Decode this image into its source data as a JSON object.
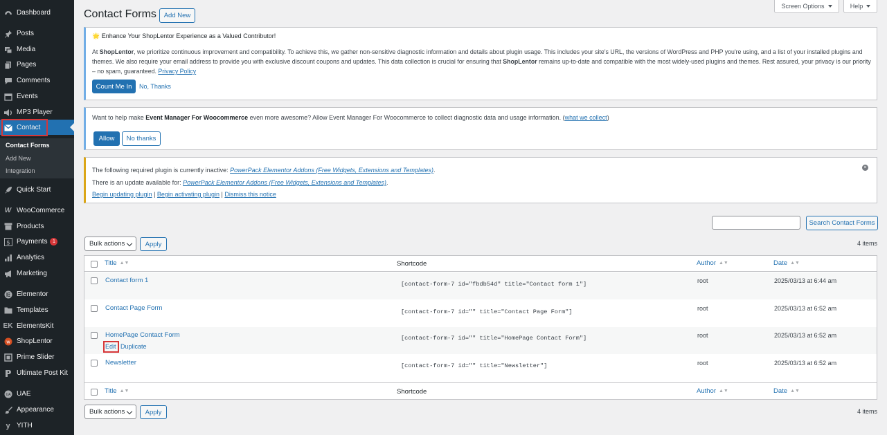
{
  "sidebar": {
    "items": [
      {
        "label": "Dashboard",
        "icon": "dashboard-icon"
      },
      {
        "label": "Posts",
        "icon": "pin-icon"
      },
      {
        "label": "Media",
        "icon": "media-icon"
      },
      {
        "label": "Pages",
        "icon": "page-icon"
      },
      {
        "label": "Comments",
        "icon": "comment-icon"
      },
      {
        "label": "Events",
        "icon": "calendar-icon"
      },
      {
        "label": "MP3 Player",
        "icon": "speaker-icon"
      },
      {
        "label": "Contact",
        "icon": "mail-icon"
      },
      {
        "label": "Quick Start",
        "icon": "rocket-icon"
      },
      {
        "label": "WooCommerce",
        "icon": "woo-icon"
      },
      {
        "label": "Products",
        "icon": "archive-icon"
      },
      {
        "label": "Payments",
        "icon": "dollar-icon",
        "badge": "1"
      },
      {
        "label": "Analytics",
        "icon": "bar-chart-icon"
      },
      {
        "label": "Marketing",
        "icon": "megaphone-icon"
      },
      {
        "label": "Elementor",
        "icon": "elementor-icon"
      },
      {
        "label": "Templates",
        "icon": "folder-icon"
      },
      {
        "label": "ElementsKit",
        "icon": "ek-icon"
      },
      {
        "label": "ShopLentor",
        "icon": "shoplentor-icon"
      },
      {
        "label": "Prime Slider",
        "icon": "slider-icon"
      },
      {
        "label": "Ultimate Post Kit",
        "icon": "upk-icon"
      },
      {
        "label": "UAE",
        "icon": "uae-icon"
      },
      {
        "label": "Appearance",
        "icon": "brush-icon"
      },
      {
        "label": "YITH",
        "icon": "yith-icon"
      }
    ],
    "submenu": [
      "Contact Forms",
      "Add New",
      "Integration"
    ]
  },
  "header": {
    "title": "Contact Forms",
    "add_new": "Add New",
    "screen_options": "Screen Options",
    "help": "Help"
  },
  "notices": {
    "shoplentor": {
      "title": "🌟 Enhance Your ShopLentor Experience as a Valued Contributor!",
      "p1_prefix": "At ",
      "p1_brand": "ShopLentor",
      "p1_text": ", we prioritize continuous improvement and compatibility. To achieve this, we gather non-sensitive diagnostic information and details about plugin usage. This includes your site's URL, the versions of WordPress and PHP you're using, and a list of your installed plugins and themes. We also require your email address to provide you with exclusive discount coupons and updates. This data collection is crucial for ensuring that ",
      "p1_brand2": "ShopLentor",
      "p1_text2": " remains up-to-date and compatible with the most widely-used plugins and themes. Rest assured, your privacy is our priority – no spam, guaranteed. ",
      "privacy": "Privacy Policy",
      "count_me_in": "Count Me In",
      "no_thanks": "No, Thanks"
    },
    "event_manager": {
      "prefix": "Want to help make ",
      "brand": "Event Manager For Woocommerce",
      "text": " even more awesome? Allow Event Manager For Woocommerce to collect diagnostic data and usage information. (",
      "link": "what we collect",
      "suffix": ")",
      "allow": "Allow",
      "no_thanks": "No thanks"
    },
    "powerpack": {
      "line1_prefix": "The following required plugin is currently inactive: ",
      "line1_link": "PowerPack Elementor Addons (Free Widgets, Extensions and Templates)",
      "line1_suffix": ".",
      "line2_prefix": "There is an update available for: ",
      "line2_link": "PowerPack Elementor Addons (Free Widgets, Extensions and Templates)",
      "line2_suffix": ".",
      "action1": "Begin updating plugin",
      "action2": "Begin activating plugin",
      "action3": "Dismiss this notice",
      "sep": " | "
    }
  },
  "search": {
    "button": "Search Contact Forms",
    "value": ""
  },
  "bulk": {
    "label": "Bulk actions",
    "apply": "Apply",
    "count": "4 items"
  },
  "table": {
    "columns": [
      "Title",
      "Shortcode",
      "Author",
      "Date"
    ],
    "rows": [
      {
        "title": "Contact form 1",
        "shortcode": "[contact-form-7 id=\"fbdb54d\" title=\"Contact form 1\"]",
        "author": "root",
        "date": "2025/03/13 at 6:44 am"
      },
      {
        "title": "Contact Page Form",
        "shortcode": "[contact-form-7 id=\"\" title=\"Contact Page Form\"]",
        "author": "root",
        "date": "2025/03/13 at 6:52 am"
      },
      {
        "title": "HomePage Contact Form",
        "shortcode": "[contact-form-7 id=\"\" title=\"HomePage Contact Form\"]",
        "author": "root",
        "date": "2025/03/13 at 6:52 am",
        "actions": [
          "Edit",
          "Duplicate"
        ]
      },
      {
        "title": "Newsletter",
        "shortcode": "[contact-form-7 id=\"\" title=\"Newsletter\"]",
        "author": "root",
        "date": "2025/03/13 at 6:52 am"
      }
    ]
  },
  "colors": {
    "accent": "#2271b1",
    "sidebar": "#1d2327",
    "highlight": "#d63638"
  }
}
